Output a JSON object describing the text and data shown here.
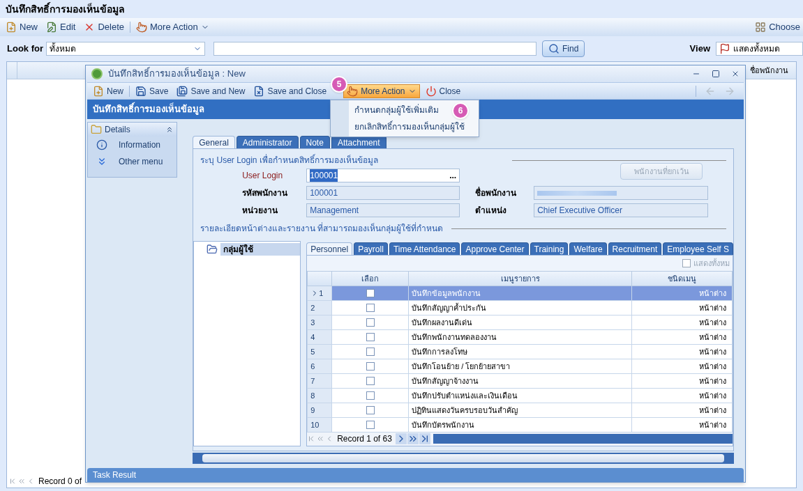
{
  "page": {
    "title": "บันทึกสิทธิ์การมองเห็นข้อมูล"
  },
  "toolbar": [
    {
      "label": "New",
      "kind": "new"
    },
    {
      "label": "Edit",
      "kind": "edit"
    },
    {
      "label": "Delete",
      "kind": "delete"
    },
    {
      "label": "More Action",
      "kind": "more"
    }
  ],
  "toolbar_right": {
    "label": "Choose"
  },
  "search": {
    "look_for_label": "Look for",
    "look_for_value": "ทั้งหมด",
    "find_button": "Find",
    "view_label": "View",
    "view_value": "แสดงทั้งหมด"
  },
  "grid": {
    "column_2": "ชื่อพนักงาน",
    "pager": "Record 0 of"
  },
  "dialog": {
    "title": "บันทึกสิทธิ์การมองเห็นข้อมูล : New",
    "toolbar": [
      {
        "label": "New",
        "kind": "new",
        "selected": false
      },
      {
        "label": "Save",
        "kind": "save",
        "selected": false
      },
      {
        "label": "Save and New",
        "kind": "save_new",
        "selected": false
      },
      {
        "label": "Save and Close",
        "kind": "save_close",
        "selected": false
      },
      {
        "label": "More Action",
        "kind": "more",
        "selected": true,
        "badge": "5"
      },
      {
        "label": "Close",
        "kind": "close",
        "selected": false
      }
    ],
    "menu": [
      {
        "label": "กำหนดกลุ่มผู้ใช้เพิ่มเติม",
        "badge": "6"
      },
      {
        "label": "ยกเลิกสิทธิ์การมองเห็นกลุ่มผู้ใช้"
      }
    ],
    "header": "บันทึกสิทธิ์การมองเห็นข้อมูล",
    "sidebar": {
      "title": "Details",
      "expanded": true,
      "items": [
        {
          "label": "Information",
          "kind": "info"
        },
        {
          "label": "Other menu",
          "kind": "more"
        }
      ]
    },
    "tabs": [
      {
        "label": "General",
        "selected": true
      },
      {
        "label": "Administrator",
        "selected": false
      },
      {
        "label": "Note",
        "selected": false
      },
      {
        "label": "Attachment",
        "selected": false
      }
    ],
    "section_1": "ระบุ User Login เพื่อกำหนดสิทธิ์การมองเห็นข้อมูล",
    "user_login": {
      "label": "User Login",
      "value": "100001",
      "button": "..."
    },
    "exclude_button": {
      "label": "พนักงานที่ยกเว้น",
      "disabled": true
    },
    "employee_id": {
      "label": "รหัสพนักงาน",
      "value": "100001"
    },
    "employee_name": {
      "label": "ชื่อพนักงาน"
    },
    "department": {
      "label": "หน่วยงาน",
      "value": "Management"
    },
    "position": {
      "label": "ตำแหน่ง",
      "value": "Chief Executive Officer"
    },
    "section_2": "รายละเอียดหน้าต่างและรายงาน ที่สามารถมองเห็นกลุ่มผู้ใช้ที่กำหนด",
    "tree": [
      {
        "label": "กลุ่มผู้ใช้",
        "selected": true
      }
    ],
    "module_tabs": [
      {
        "label": "Personnel",
        "selected": true
      },
      {
        "label": "Payroll",
        "selected": false
      },
      {
        "label": "Time Attendance",
        "selected": false
      },
      {
        "label": "Approve Center",
        "selected": false
      },
      {
        "label": "Training",
        "selected": false
      },
      {
        "label": "Welfare",
        "selected": false
      },
      {
        "label": "Recruitment",
        "selected": false
      },
      {
        "label": "Employee Self S",
        "selected": false
      }
    ],
    "show_all": {
      "label": "แสดงทั้งหม",
      "checked": false
    },
    "table": {
      "columns": [
        "เลือก",
        "เมนูรายการ",
        "ชนิดเมนู"
      ],
      "rows": [
        {
          "no": "1",
          "checked": false,
          "menu": "บันทึกข้อมูลพนักงาน",
          "type": "หน้าต่าง",
          "selected": true
        },
        {
          "no": "2",
          "checked": false,
          "menu": "บันทึกสัญญาค้ำประกัน",
          "type": "หน้าต่าง",
          "selected": false
        },
        {
          "no": "3",
          "checked": false,
          "menu": "บันทึกผลงานดีเด่น",
          "type": "หน้าต่าง",
          "selected": false
        },
        {
          "no": "4",
          "checked": false,
          "menu": "บันทึกพนักงานทดลองงาน",
          "type": "หน้าต่าง",
          "selected": false
        },
        {
          "no": "5",
          "checked": false,
          "menu": "บันทึกการลงโทษ",
          "type": "หน้าต่าง",
          "selected": false
        },
        {
          "no": "6",
          "checked": false,
          "menu": "บันทึกโอนย้าย / โยกย้ายสาขา",
          "type": "หน้าต่าง",
          "selected": false
        },
        {
          "no": "7",
          "checked": false,
          "menu": "บันทึกสัญญาจ้างงาน",
          "type": "หน้าต่าง",
          "selected": false
        },
        {
          "no": "8",
          "checked": false,
          "menu": "บันทึกปรับตำแหน่งและเงินเดือน",
          "type": "หน้าต่าง",
          "selected": false
        },
        {
          "no": "9",
          "checked": false,
          "menu": "ปฏิทินแสดงวันครบรอบวันสำคัญ",
          "type": "หน้าต่าง",
          "selected": false
        },
        {
          "no": "10",
          "checked": false,
          "menu": "บันทึกบัตรพนักงาน",
          "type": "หน้าต่าง",
          "selected": false
        }
      ],
      "pager": "Record 1 of 63"
    },
    "task_result": "Task Result"
  }
}
